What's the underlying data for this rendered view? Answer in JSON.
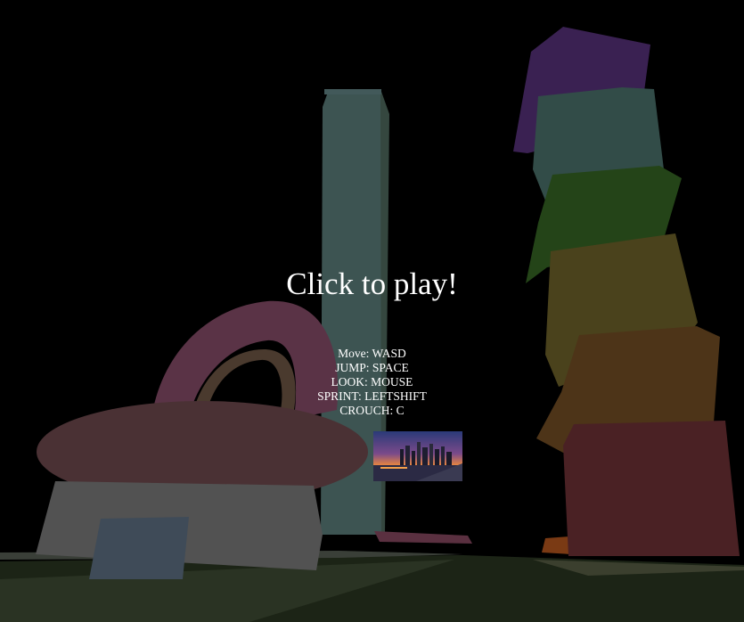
{
  "overlay": {
    "title": "Click to play!",
    "controls": [
      "Move: WASD",
      "JUMP: SPACE",
      "LOOK: MOUSE",
      "SPRINT: LEFTSHIFT",
      "CROUCH: C"
    ],
    "thumbnail": "city-skyline-sunset-image"
  },
  "colors": {
    "sky": "#000000",
    "tower": "#3d5452",
    "ring": "#5a3346",
    "ring_inner": "#4a3a2e",
    "torus": "#4a3134",
    "block": "#525252",
    "block_window": "#3f4b58",
    "ground": "#2a3323",
    "stack_purple": "#3a2152",
    "stack_teal": "#324c48",
    "stack_green": "#244418",
    "stack_olive": "#4a421c",
    "stack_brown": "#4d3418",
    "stack_maroon": "#4a2124"
  }
}
